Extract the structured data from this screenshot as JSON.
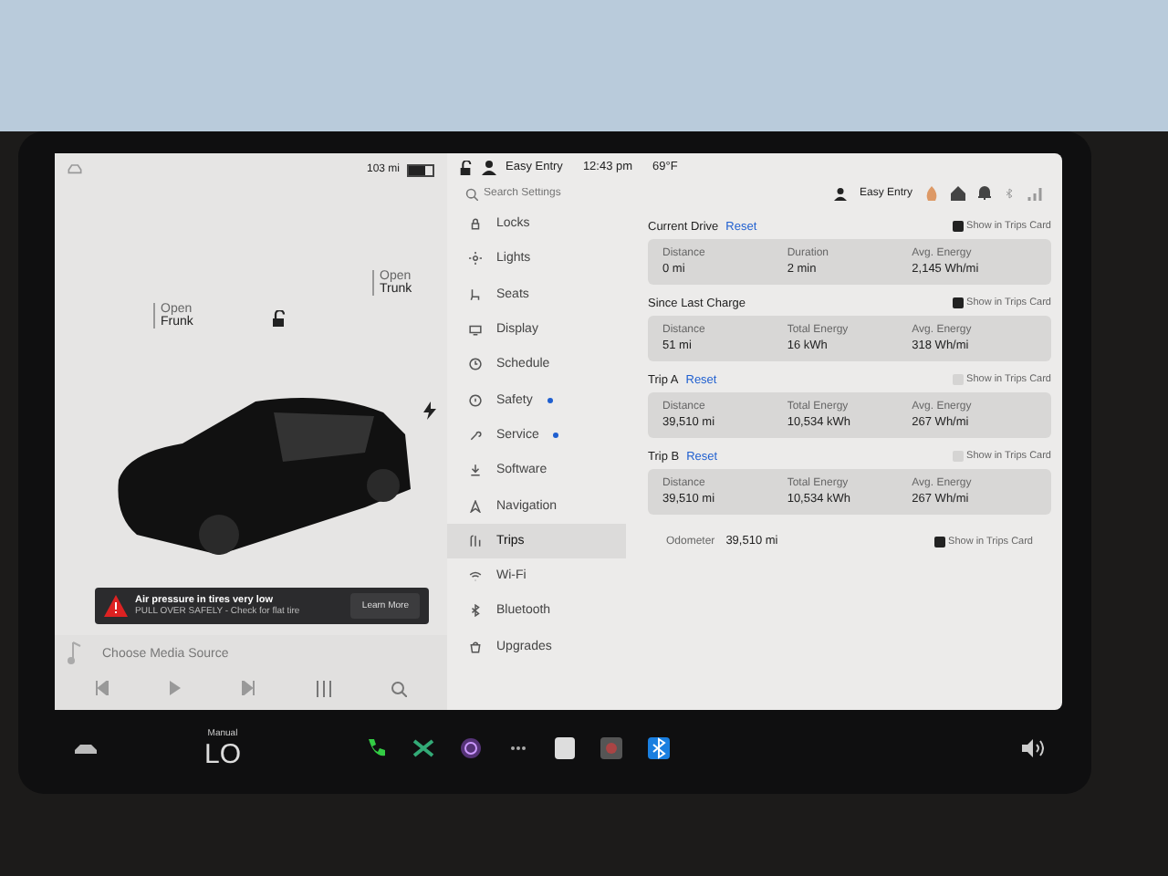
{
  "status_bar": {
    "range": "103 mi",
    "profile": "Easy Entry",
    "time": "12:43 pm",
    "temperature": "69°F"
  },
  "car_panel": {
    "frunk": {
      "action": "Open",
      "label": "Frunk"
    },
    "trunk": {
      "action": "Open",
      "label": "Trunk"
    },
    "alert": {
      "title": "Air pressure in tires very low",
      "message": "PULL OVER SAFELY - Check for flat tire",
      "button": "Learn More"
    },
    "media": {
      "label": "Choose Media Source"
    }
  },
  "settings": {
    "search": {
      "placeholder": "Search Settings"
    },
    "profile": "Easy Entry",
    "menu": [
      {
        "label": "Locks",
        "kind": "lock",
        "selected": false,
        "dot": false
      },
      {
        "label": "Lights",
        "kind": "sun",
        "selected": false,
        "dot": false
      },
      {
        "label": "Seats",
        "kind": "seat",
        "selected": false,
        "dot": false
      },
      {
        "label": "Display",
        "kind": "screen",
        "selected": false,
        "dot": false
      },
      {
        "label": "Schedule",
        "kind": "clock",
        "selected": false,
        "dot": false
      },
      {
        "label": "Safety",
        "kind": "circle",
        "selected": false,
        "dot": true
      },
      {
        "label": "Service",
        "kind": "wrench",
        "selected": false,
        "dot": true
      },
      {
        "label": "Software",
        "kind": "download",
        "selected": false,
        "dot": false
      },
      {
        "label": "Navigation",
        "kind": "arrow",
        "selected": false,
        "dot": false
      },
      {
        "label": "Trips",
        "kind": "trips",
        "selected": true,
        "dot": false
      },
      {
        "label": "Wi-Fi",
        "kind": "wifi",
        "selected": false,
        "dot": false
      },
      {
        "label": "Bluetooth",
        "kind": "bluetooth",
        "selected": false,
        "dot": false
      },
      {
        "label": "Upgrades",
        "kind": "bag",
        "selected": false,
        "dot": false
      }
    ]
  },
  "trips": [
    {
      "title": "Current Drive",
      "reset": "Reset",
      "show_in_card": {
        "label": "Show in Trips Card",
        "checked": true
      },
      "stats": [
        {
          "label": "Distance",
          "value": "0 mi"
        },
        {
          "label": "Duration",
          "value": "2 min"
        },
        {
          "label": "Avg. Energy",
          "value": "2,145 Wh/mi"
        }
      ]
    },
    {
      "title": "Since Last Charge",
      "show_in_card": {
        "label": "Show in Trips Card",
        "checked": true
      },
      "stats": [
        {
          "label": "Distance",
          "value": "51 mi"
        },
        {
          "label": "Total Energy",
          "value": "16 kWh"
        },
        {
          "label": "Avg. Energy",
          "value": "318 Wh/mi"
        }
      ]
    },
    {
      "title": "Trip A",
      "reset": "Reset",
      "show_in_card": {
        "label": "Show in Trips Card",
        "checked": false
      },
      "stats": [
        {
          "label": "Distance",
          "value": "39,510 mi"
        },
        {
          "label": "Total Energy",
          "value": "10,534 kWh"
        },
        {
          "label": "Avg. Energy",
          "value": "267 Wh/mi"
        }
      ]
    },
    {
      "title": "Trip B",
      "reset": "Reset",
      "show_in_card": {
        "label": "Show in Trips Card",
        "checked": false
      },
      "stats": [
        {
          "label": "Distance",
          "value": "39,510 mi"
        },
        {
          "label": "Total Energy",
          "value": "10,534 kWh"
        },
        {
          "label": "Avg. Energy",
          "value": "267 Wh/mi"
        }
      ]
    }
  ],
  "odometer": {
    "label": "Odometer",
    "value": "39,510 mi",
    "show_in_card": {
      "label": "Show in Trips Card",
      "checked": true
    }
  },
  "dock": {
    "climate_mode": "Manual",
    "temperature": "LO"
  }
}
